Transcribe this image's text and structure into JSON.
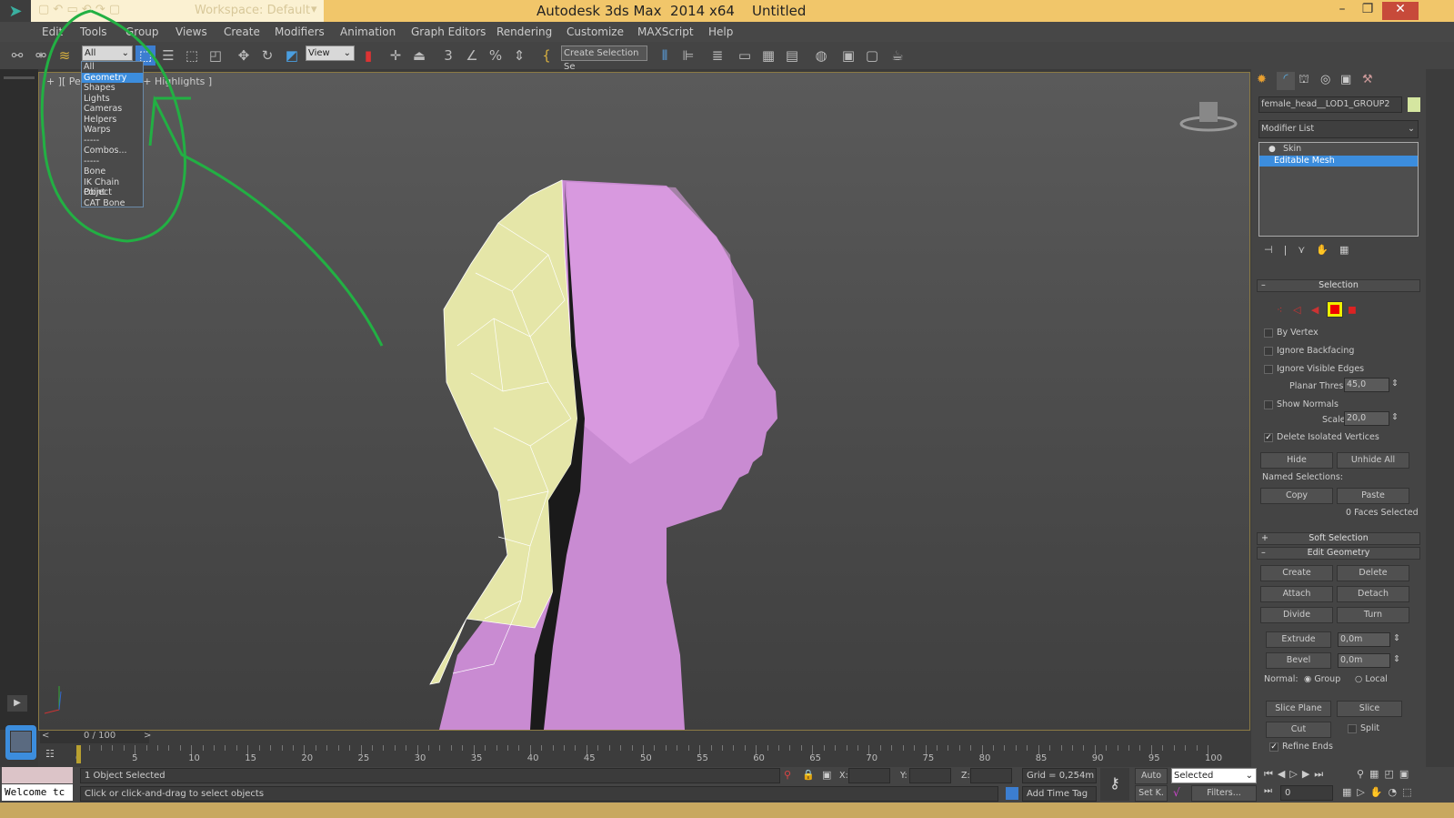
{
  "titlebar": {
    "workspace": "Workspace: Default",
    "app_title": "Autodesk 3ds Max  2014 x64",
    "doc_title": "Untitled",
    "minimize": "–",
    "maximize": "❐",
    "close": "✕"
  },
  "menu": [
    "Edit",
    "Tools",
    "Group",
    "Views",
    "Create",
    "Modifiers",
    "Animation",
    "Graph Editors",
    "Rendering",
    "Customize",
    "MAXScript",
    "Help"
  ],
  "toolbar": {
    "selection_filter": "All",
    "reference_coord": "View",
    "named_selection": "Create Selection Se"
  },
  "selection_filter_dropdown": {
    "items": [
      "All",
      "Geometry",
      "Shapes",
      "Lights",
      "Cameras",
      "Helpers",
      "Warps",
      "-----",
      "Combos...",
      "-----",
      "Bone",
      "IK Chain Object",
      "Point",
      "CAT Bone"
    ],
    "highlighted": "Geometry"
  },
  "viewport": {
    "label": "+ ][ Pers",
    "label_tail": "ooth + Highlights ]",
    "colors": {
      "skin": "#c98bd2",
      "hair": "#e5e6a8",
      "annotation": "#22b043"
    }
  },
  "command_panel": {
    "tabs": [
      "create",
      "modify",
      "hierarchy",
      "motion",
      "display",
      "utilities"
    ],
    "object_name": "female_head__LOD1_GROUP2",
    "modifier_list": "Modifier List",
    "stack": [
      "Skin",
      "Editable Mesh"
    ],
    "stack_selected": "Editable Mesh",
    "selection": {
      "title": "Selection",
      "by_vertex": "By Vertex",
      "ignore_backfacing": "Ignore Backfacing",
      "ignore_visible_edges": "Ignore Visible Edges",
      "planar_thresh_label": "Planar Thresh:",
      "planar_thresh": "45,0",
      "show_normals": "Show Normals",
      "scale_label": "Scale:",
      "scale": "20,0",
      "delete_isolated": "Delete Isolated Vertices",
      "hide": "Hide",
      "unhide_all": "Unhide All",
      "named_selections": "Named Selections:",
      "copy": "Copy",
      "paste": "Paste",
      "status": "0 Faces Selected"
    },
    "soft_selection": "Soft Selection",
    "edit_geometry": {
      "title": "Edit Geometry",
      "create": "Create",
      "delete": "Delete",
      "attach": "Attach",
      "detach": "Detach",
      "divide": "Divide",
      "turn": "Turn",
      "extrude": "Extrude",
      "extrude_val": "0,0m",
      "bevel": "Bevel",
      "bevel_val": "0,0m",
      "normal_label": "Normal:",
      "group": "Group",
      "local": "Local",
      "slice_plane": "Slice Plane",
      "slice": "Slice",
      "cut": "Cut",
      "split": "Split",
      "refine_ends": "Refine Ends"
    }
  },
  "timeline": {
    "frame": "0 / 100",
    "prev": "<",
    "next": ">",
    "ticks": [
      0,
      5,
      10,
      15,
      20,
      25,
      30,
      35,
      40,
      45,
      50,
      55,
      60,
      65,
      70,
      75,
      80,
      85,
      90,
      95,
      100
    ]
  },
  "status": {
    "listener": "Welcome tc",
    "selected": "1 Object Selected",
    "prompt": "Click or click-and-drag to select objects",
    "x_label": "X:",
    "y_label": "Y:",
    "z_label": "Z:",
    "grid": "Grid = 0,254m",
    "add_time_tag": "Add Time Tag",
    "auto": "Auto",
    "set_key": "Set K.",
    "key_filter": "Selected",
    "filters": "Filters...",
    "current_frame": "0"
  }
}
